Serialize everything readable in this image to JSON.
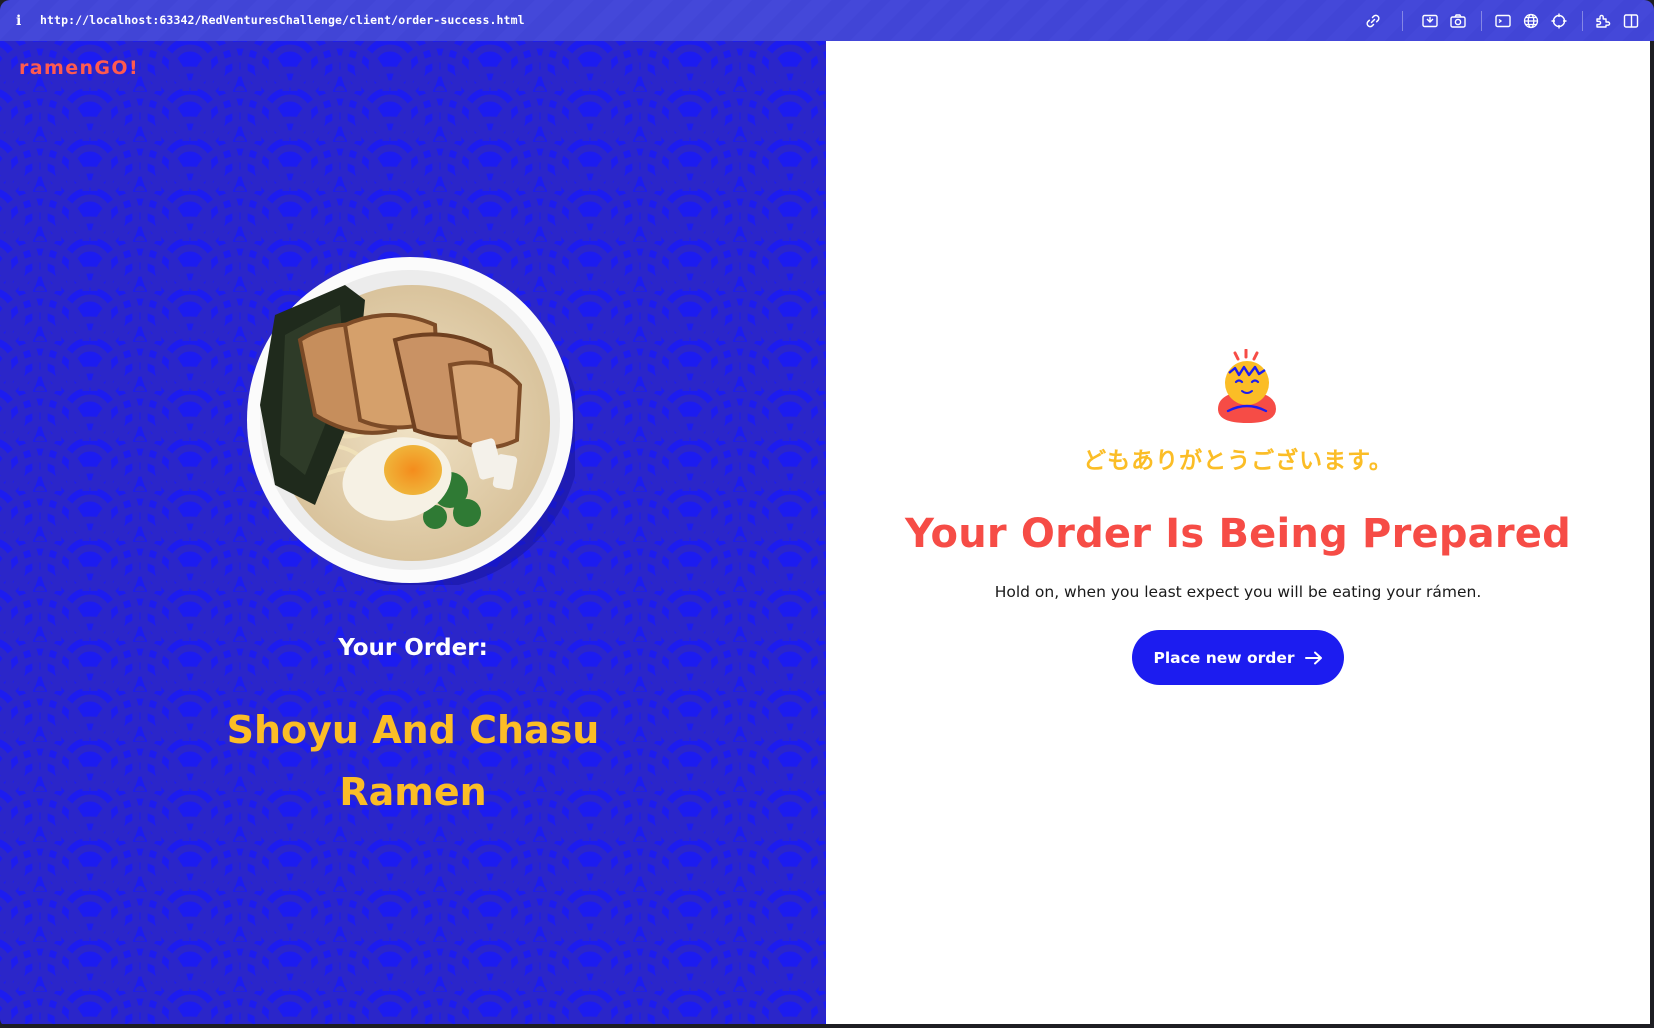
{
  "browser": {
    "info_glyph": "i",
    "url": "http://localhost:63342/RedVenturesChallenge/client/order-success.html",
    "toolbar_icons": [
      "link-icon",
      "screen-capture-icon",
      "camera-icon",
      "terminal-icon",
      "globe-icon",
      "crosshair-icon",
      "extensions-icon",
      "sidebar-icon"
    ]
  },
  "brand": {
    "logo": "ramenGO!"
  },
  "order": {
    "label": "Your Order:",
    "name": "Shoyu And Chasu Ramen",
    "image": "ramen-bowl-image"
  },
  "confirmation": {
    "mascot": "ramen-mascot-icon",
    "japanese": "どもありがとうございます。",
    "headline": "Your Order Is Being Prepared",
    "message": "Hold on, when you least expect you will be eating your rámen.",
    "button_label": "Place new order"
  },
  "colors": {
    "brand_blue": "#1c1cf0",
    "brand_red": "#f64c46",
    "brand_yellow": "#fbbd26",
    "address_bar": "#4145d6"
  }
}
